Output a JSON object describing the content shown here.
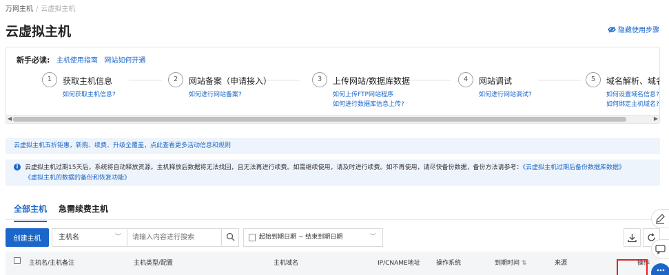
{
  "breadcrumb": {
    "root": "万网主机",
    "current": "云虚拟主机"
  },
  "page_title": "云虚拟主机",
  "hide_steps_label": "隐藏使用步骤",
  "guide": {
    "heading": "新手必读:",
    "links": [
      "主机使用指南",
      "网站如何开通"
    ],
    "steps": [
      {
        "num": "1",
        "title": "获取主机信息",
        "links": [
          "如何获取主机信息?"
        ]
      },
      {
        "num": "2",
        "title": "网站备案（申请接入）",
        "links": [
          "如何进行网站备案?"
        ]
      },
      {
        "num": "3",
        "title": "上传网站/数据库数据",
        "links": [
          "如何上传FTP网站程序",
          "如何进行数据库信息上传?"
        ]
      },
      {
        "num": "4",
        "title": "网站调试",
        "links": [
          "如何进行网站调试?"
        ]
      },
      {
        "num": "5",
        "title": "域名解析、域名绑",
        "links": [
          "如何设置域名信息?",
          "如何绑定主机域名?"
        ]
      }
    ]
  },
  "promo_text": "云虚拟主机五折钜惠，新购、续费、升级全覆盖，点此查看更多活动信息和规则",
  "notice": {
    "text": "云虚拟主机过期15天后，系统将自动释放资源。主机释放后数据将无法找回，且无法再进行续费。如需继续使用，请及时进行续费。如不再使用，请尽快备份数据，备份方法请参考：",
    "link1": "《云虚拟主机过期后备份数据库数据》",
    "link2": "《虚拟主机的数据的备份和恢复功能》"
  },
  "tabs": [
    {
      "label": "全部主机",
      "active": true
    },
    {
      "label": "急需续费主机",
      "active": false
    }
  ],
  "toolbar": {
    "create_label": "创建主机",
    "filter_select": "主机名",
    "search_placeholder": "请输入内容进行搜索",
    "date_range": "起始到期日期 ~ 结束到期日期"
  },
  "table": {
    "columns": [
      "主机名/主机备注",
      "主机类型/配置",
      "主机域名",
      "IP/CNAME地址",
      "操作系统",
      "到期时间",
      "来源",
      "操作"
    ]
  },
  "icons": {
    "hide": "eye-off-icon",
    "info": "info-icon",
    "search": "search-icon",
    "calendar": "calendar-icon",
    "download": "download-icon",
    "refresh": "refresh-icon",
    "sort": "sort-icon",
    "edit": "edit-icon",
    "chat": "chat-icon"
  },
  "colors": {
    "accent": "#1a66c9",
    "highlight": "#e02020"
  }
}
